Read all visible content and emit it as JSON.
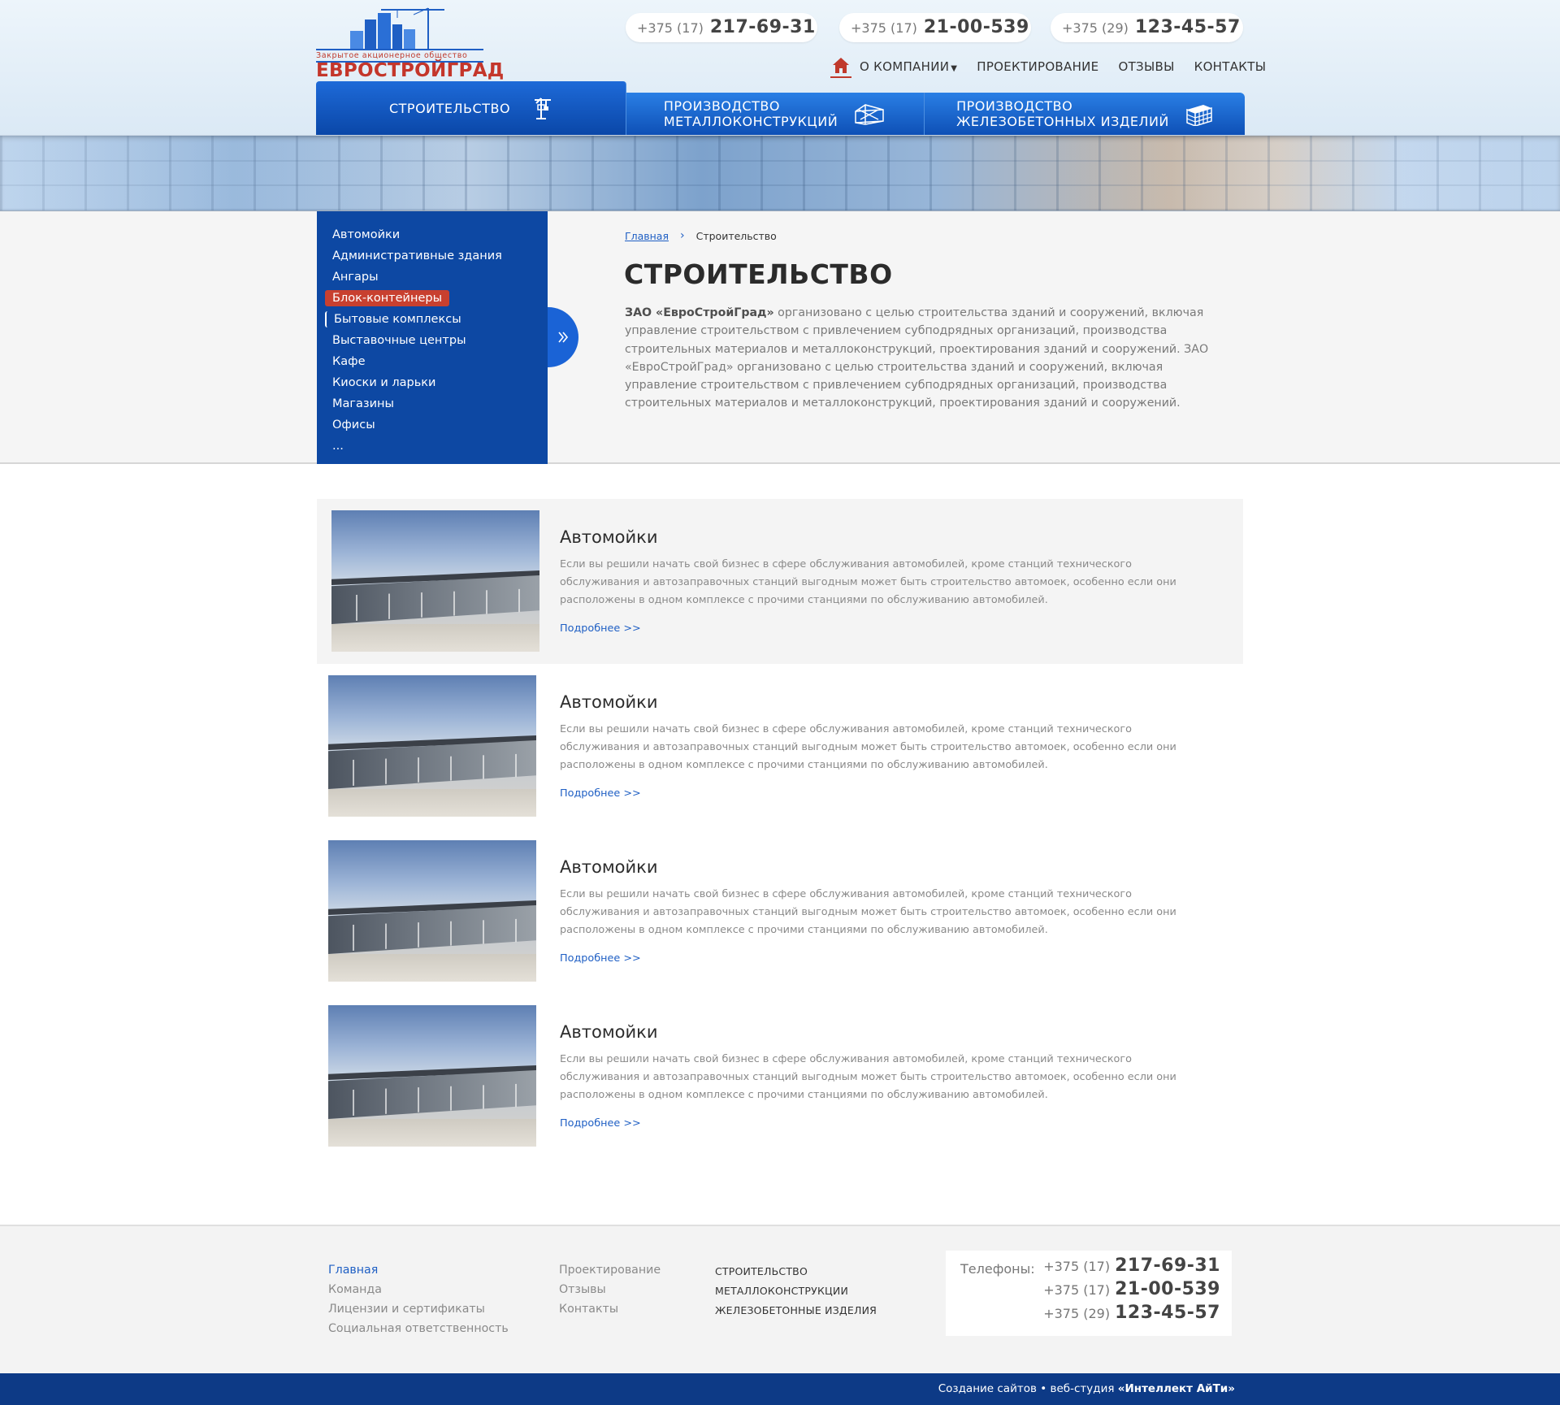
{
  "brand": {
    "subtitle": "Закрытое акционерное общество",
    "name": "ЕВРОСТРОЙГРАД",
    "accent": "#c4362b",
    "primary": "#0d48a3"
  },
  "header": {
    "phones": [
      {
        "code": "+375 (17)",
        "number": "217-69-31"
      },
      {
        "code": "+375 (17)",
        "number": "21-00-539"
      },
      {
        "code": "+375 (29)",
        "number": "123-45-57"
      }
    ],
    "nav": {
      "home_icon": "home-icon",
      "company": "О КОМПАНИИ",
      "design": "ПРОЕКТИРОВАНИЕ",
      "reviews": "ОТЗЫВЫ",
      "contacts": "КОНТАКТЫ"
    },
    "tabs": {
      "construction": "СТРОИТЕЛЬСТВО",
      "metal_line1": "ПРОИЗВОДСТВО",
      "metal_line2": "МЕТАЛЛОКОНСТРУКЦИЙ",
      "concrete_line1": "ПРОИЗВОДСТВО",
      "concrete_line2": "ЖЕЛЕЗОБЕТОННЫХ ИЗДЕЛИЙ"
    }
  },
  "sidebar": {
    "items": [
      "Автомойки",
      "Административные здания",
      "Ангары",
      "Блок-контейнеры",
      "Бытовые комплексы",
      "Выставочные центры",
      "Кафе",
      "Киоски и ларьки",
      "Магазины",
      "Офисы",
      "..."
    ],
    "active_index": 3
  },
  "main": {
    "breadcrumb": {
      "home": "Главная",
      "current": "Строительство"
    },
    "title": "СТРОИТЕЛЬСТВО",
    "intro_company": "ЗАО «ЕвроСтройГрад»",
    "intro_text": " организовано с целью строительства зданий и сооружений, включая управление строительством с привлечением субподрядных организаций, производства строительных материалов и металлоконструкций, проектирования зданий и сооружений. ЗАО «ЕвроСтройГрад» организовано с целью строительства зданий и сооружений, включая управление строительством с привлечением субподрядных организаций, производства строительных материалов и металлоконструкций, проектирования зданий и сооружений."
  },
  "items": [
    {
      "title": "Автомойки",
      "text": "Если вы решили начать свой бизнес в сфере обслуживания автомобилей, кроме станций технического обслуживания и автозаправочных станций выгодным может быть строительство автомоек, особенно если они расположены в одном комплексе с прочими станциями по обслуживанию автомобилей.",
      "more": "Подробнее >>"
    },
    {
      "title": "Автомойки",
      "text": "Если вы решили начать свой бизнес в сфере обслуживания автомобилей, кроме станций технического обслуживания и автозаправочных станций выгодным может быть строительство автомоек, особенно если они расположены в одном комплексе с прочими станциями по обслуживанию автомобилей.",
      "more": "Подробнее >>"
    },
    {
      "title": "Автомойки",
      "text": "Если вы решили начать свой бизнес в сфере обслуживания автомобилей, кроме станций технического обслуживания и автозаправочных станций выгодным может быть строительство автомоек, особенно если они расположены в одном комплексе с прочими станциями по обслуживанию автомобилей.",
      "more": "Подробнее >>"
    },
    {
      "title": "Автомойки",
      "text": "Если вы решили начать свой бизнес в сфере обслуживания автомобилей, кроме станций технического обслуживания и автозаправочных станций выгодным может быть строительство автомоек, особенно если они расположены в одном комплексе с прочими станциями по обслуживанию автомобилей.",
      "more": "Подробнее >>"
    }
  ],
  "footer": {
    "col1": [
      "Главная",
      "Команда",
      "Лицензии и сертификаты",
      "Социальная ответственность"
    ],
    "col2": [
      "Проектирование",
      "Отзывы",
      "Контакты"
    ],
    "col3": [
      "СТРОИТЕЛЬСТВО",
      "МЕТАЛЛОКОНСТРУКЦИИ",
      "ЖЕЛЕЗОБЕТОННЫЕ ИЗДЕЛИЯ"
    ],
    "phones_label": "Телефоны:",
    "phones": [
      {
        "code": "+375 (17)",
        "number": "217-69-31"
      },
      {
        "code": "+375 (17)",
        "number": "21-00-539"
      },
      {
        "code": "+375 (29)",
        "number": "123-45-57"
      }
    ],
    "credit_prefix": "Создание сайтов",
    "credit_mid": " веб-студия ",
    "credit_studio": "«Интеллект АйТи»"
  }
}
